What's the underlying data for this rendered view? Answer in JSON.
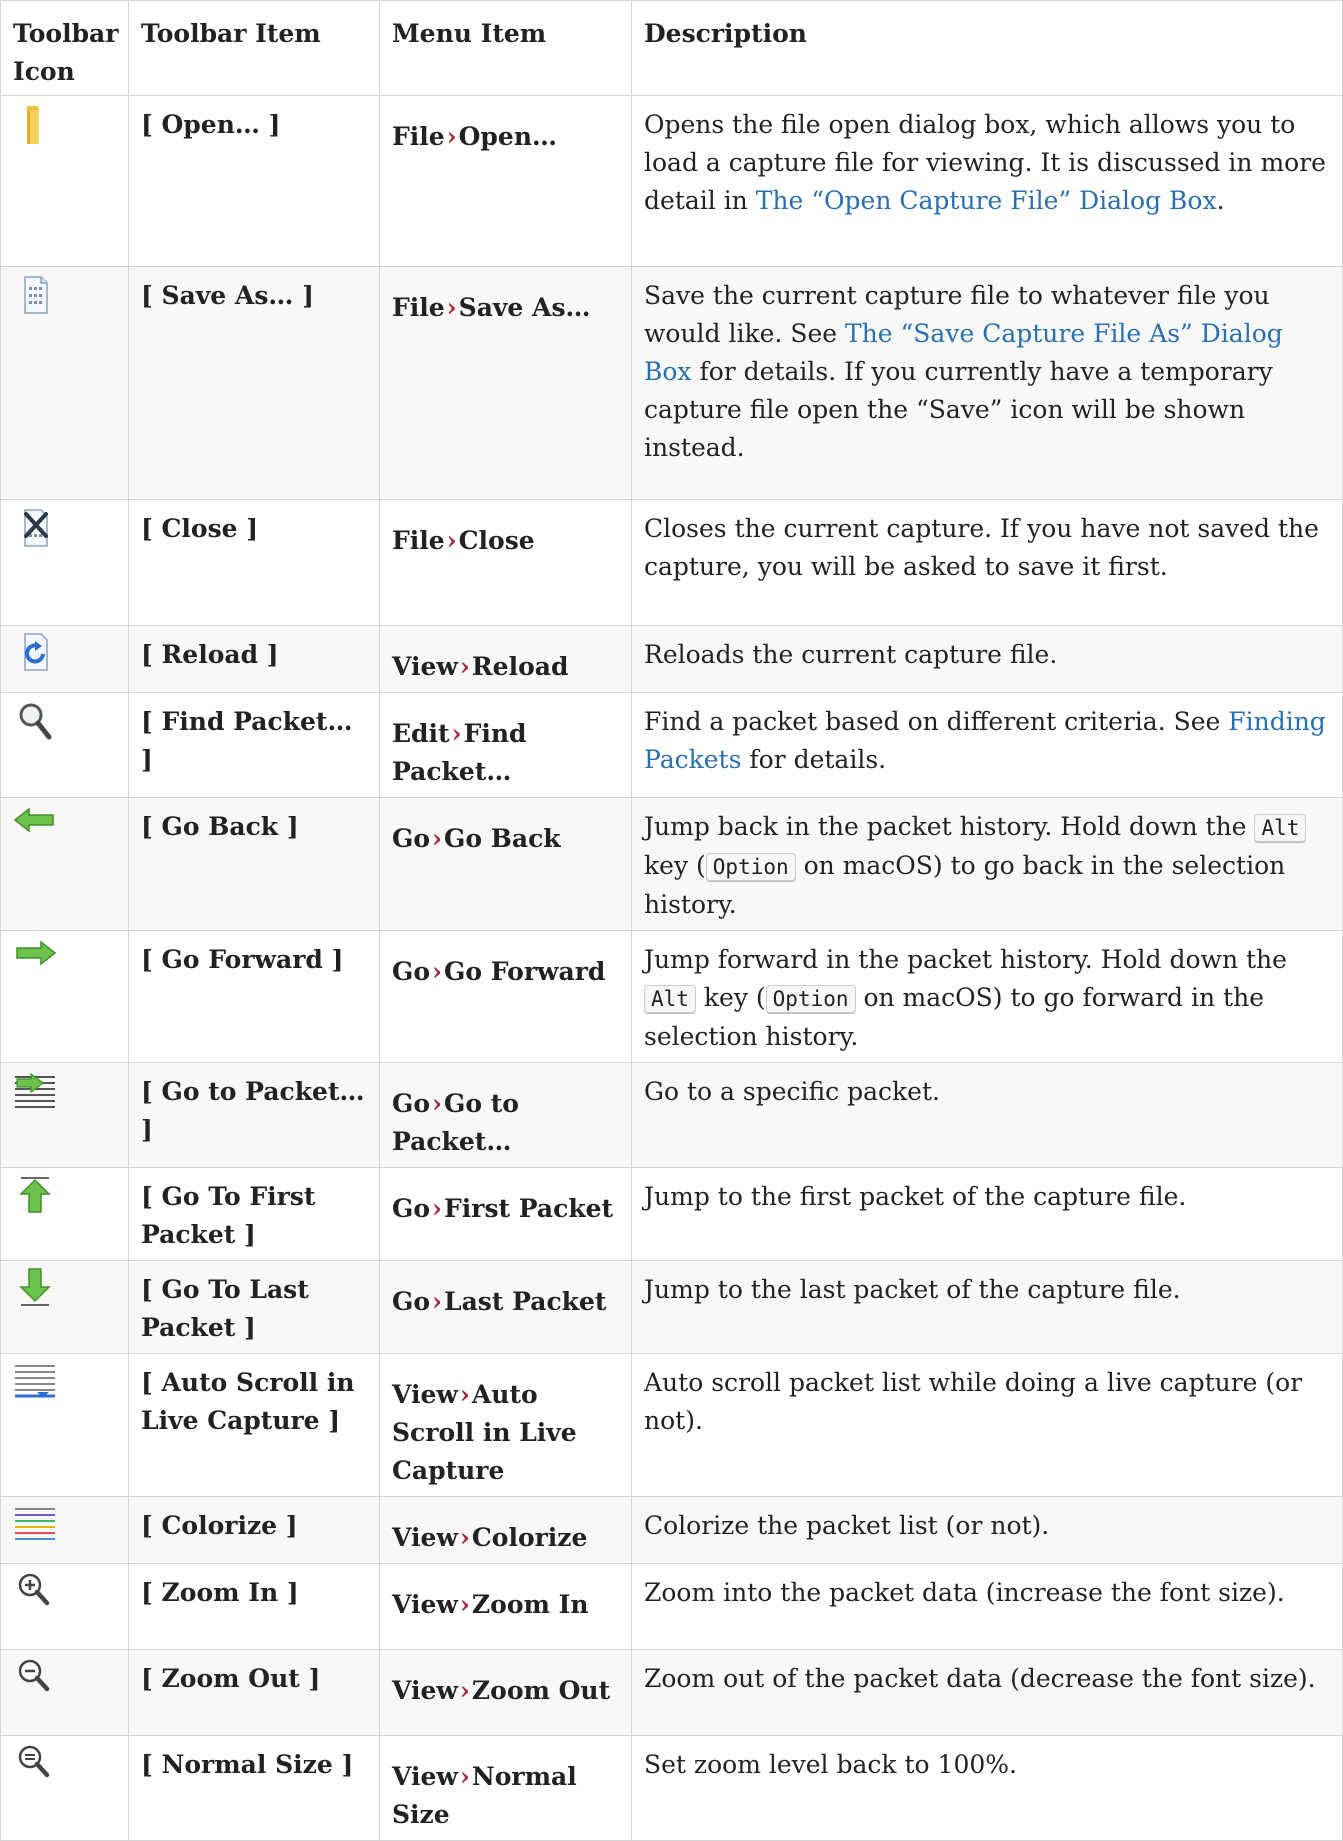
{
  "headers": {
    "icon": "Toolbar Icon",
    "item": "Toolbar Item",
    "menu": "Menu Item",
    "desc": "Description"
  },
  "separator": "›",
  "rows": [
    {
      "icon": "folder-icon",
      "item": "[ Open… ]",
      "menu_a": "File",
      "menu_b": "Open…",
      "desc_before": "Opens the file open dialog box, which allows you to load a capture file for viewing. It is discussed in more detail in ",
      "desc_link": "The “Open Capture File” Dialog Box",
      "desc_after": "."
    },
    {
      "icon": "save-file-icon",
      "item": "[ Save As… ]",
      "menu_a": "File",
      "menu_b": "Save As…",
      "desc_before": "Save the current capture file to whatever file you would like. See ",
      "desc_link": "The “Save Capture File As” Dialog Box",
      "desc_after": " for details. If you currently have a temporary capture file open the “Save” icon will be shown instead."
    },
    {
      "icon": "close-file-icon",
      "item": "[ Close ]",
      "menu_a": "File",
      "menu_b": "Close",
      "desc": "Closes the current capture. If you have not saved the capture, you will be asked to save it first."
    },
    {
      "icon": "reload-icon",
      "item": "[ Reload ]",
      "menu_a": "View",
      "menu_b": "Reload",
      "desc": "Reloads the current capture file."
    },
    {
      "icon": "find-icon",
      "item": "[ Find Packet… ]",
      "menu_a": "Edit",
      "menu_b": "Find Packet…",
      "desc_before": "Find a packet based on different criteria. See ",
      "desc_link": "Finding Packets",
      "desc_after": " for details."
    },
    {
      "icon": "go-back-icon",
      "item": "[ Go Back ]",
      "menu_a": "Go",
      "menu_b": "Go Back",
      "desc_1": "Jump back in the packet history. Hold down the ",
      "key1": "Alt",
      "desc_2": " key (",
      "key2": "Option",
      "desc_3": " on macOS) to go back in the selection history."
    },
    {
      "icon": "go-forward-icon",
      "item": "[ Go Forward ]",
      "menu_a": "Go",
      "menu_b": "Go Forward",
      "desc_1": "Jump forward in the packet history. Hold down the ",
      "key1": "Alt",
      "desc_2": " key (",
      "key2": "Option",
      "desc_3": " on macOS) to go forward in the selection history."
    },
    {
      "icon": "go-to-packet-icon",
      "item": "[ Go to Packet… ]",
      "menu_a": "Go",
      "menu_b": "Go to Packet…",
      "desc": "Go to a specific packet."
    },
    {
      "icon": "first-packet-icon",
      "item": "[ Go To First Packet ]",
      "menu_a": "Go",
      "menu_b": "First Packet",
      "desc": "Jump to the first packet of the capture file."
    },
    {
      "icon": "last-packet-icon",
      "item": "[ Go To Last Packet ]",
      "menu_a": "Go",
      "menu_b": "Last Packet",
      "desc": "Jump to the last packet of the capture file."
    },
    {
      "icon": "auto-scroll-icon",
      "item": "[ Auto Scroll in Live Capture ]",
      "menu_a": "View",
      "menu_b": "Auto Scroll in Live Capture",
      "desc": "Auto scroll packet list while doing a live capture (or not)."
    },
    {
      "icon": "colorize-icon",
      "item": "[ Colorize ]",
      "menu_a": "View",
      "menu_b": "Colorize",
      "desc": "Colorize the packet list (or not)."
    },
    {
      "icon": "zoom-in-icon",
      "item": "[ Zoom In ]",
      "menu_a": "View",
      "menu_b": "Zoom In",
      "desc": "Zoom into the packet data (increase the font size)."
    },
    {
      "icon": "zoom-out-icon",
      "item": "[ Zoom Out ]",
      "menu_a": "View",
      "menu_b": "Zoom Out",
      "desc": "Zoom out of the packet data (decrease the font size)."
    },
    {
      "icon": "normal-size-icon",
      "item": "[ Normal Size ]",
      "menu_a": "View",
      "menu_b": "Normal Size",
      "desc": "Set zoom level back to 100%."
    }
  ]
}
